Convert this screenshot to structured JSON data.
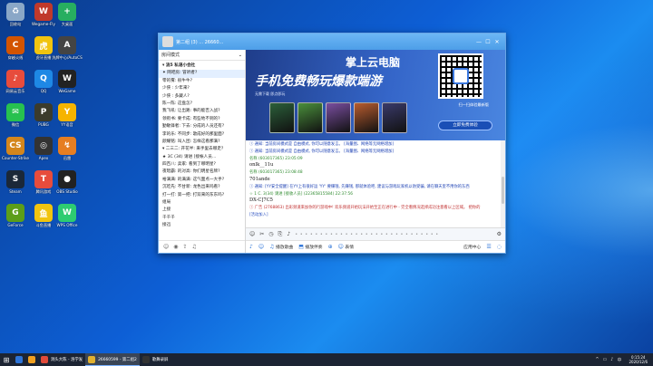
{
  "desktop": {
    "icons": [
      {
        "label": "回收站",
        "color": "#8aa7c7",
        "glyph": "♻"
      },
      {
        "label": "Wegame-Fly",
        "color": "#c0392b",
        "glyph": "W"
      },
      {
        "label": "大桌面",
        "color": "#27ae60",
        "glyph": "+"
      },
      {
        "label": "穿越火线",
        "color": "#d35400",
        "glyph": "C"
      },
      {
        "label": "虎牙直播",
        "color": "#f1c40f",
        "glyph": "虎"
      },
      {
        "label": "洗牌中心/AutoCS",
        "color": "#444",
        "glyph": "A"
      },
      {
        "label": "网易云音乐",
        "color": "#e74c3c",
        "glyph": "♪"
      },
      {
        "label": "QQ",
        "color": "#1e88e5",
        "glyph": "Q"
      },
      {
        "label": "WeGame",
        "color": "#222",
        "glyph": "W"
      },
      {
        "label": "微信",
        "color": "#27c14f",
        "glyph": "✉"
      },
      {
        "label": "PUBG",
        "color": "#3b3b2c",
        "glyph": "P"
      },
      {
        "label": "YY语音",
        "color": "#f6b400",
        "glyph": "Y"
      },
      {
        "label": "Counter-Strike",
        "color": "#d4861c",
        "glyph": "CS"
      },
      {
        "label": "Apex",
        "color": "#333",
        "glyph": "◎"
      },
      {
        "label": "迅雷",
        "color": "#e67e22",
        "glyph": "↯"
      },
      {
        "label": "Steam",
        "color": "#1b2838",
        "glyph": "S"
      },
      {
        "label": "腾讯游戏",
        "color": "#e74c3c",
        "glyph": "T"
      },
      {
        "label": "OBS Studio",
        "color": "#222",
        "glyph": "●"
      },
      {
        "label": "GeForce",
        "color": "#5c9e1a",
        "glyph": "G"
      },
      {
        "label": "斗鱼直播",
        "color": "#f1c40f",
        "glyph": "鱼"
      },
      {
        "label": "WPS Office",
        "color": "#2ecc71",
        "glyph": "W"
      }
    ]
  },
  "window": {
    "title": "第二组 (3‍) ... 26660...",
    "min": "—",
    "max": "☐",
    "close": "✕"
  },
  "left_panel": {
    "header_label": "房间模式",
    "header_icon": "⌄",
    "rows": [
      {
        "text": "▾ 流5 私语小会社",
        "group": true
      },
      {
        "text": "✦ 网吧房: 冒听者?",
        "sel": true
      },
      {
        "text": "零的雾: 很牛牛?"
      },
      {
        "text": "少侠 : 少年来?"
      },
      {
        "text": "少侠 : 多藏人?"
      },
      {
        "text": "陈一陈: 这盘怎?"
      },
      {
        "text": "我飞吼: 让出路: 事的能否入战?"
      },
      {
        "text": "领衔书: 要卡成: 有些地不到的?"
      },
      {
        "text": "勤敏锋者: 下去: 分成的人员还有?"
      },
      {
        "text": "李的乐: 不同步: 歌成好的那里面?"
      },
      {
        "text": "颜耀铭: 叫入团: 怎样这看那满?"
      },
      {
        "text": "▾ 二三二: 开花半: 来手里去哪走?"
      },
      {
        "text": "  ★ 3C (34) 请进 [接帐人员..."
      },
      {
        "text": "四百八: 卖家: 看到了哪明星?"
      },
      {
        "text": "夜暗霸: 的对高: 你们明星名牌?"
      },
      {
        "text": "裕满满: 的满满: 这气面点一大手?"
      },
      {
        "text": "沉吃先: 不甘新: 龙色出来吗看?"
      },
      {
        "text": "打一打: 第一把: 打双来的东东吗?"
      },
      {
        "text": "组局"
      },
      {
        "text": "上接"
      },
      {
        "text": "千千千"
      },
      {
        "text": "接迅"
      }
    ],
    "footer_icons": [
      "☺",
      "◉",
      "⇪",
      "♫"
    ]
  },
  "banner": {
    "title": "掌上云电脑",
    "headline": "手机免费畅玩爆款端游",
    "small_text": "无需下载 即点即玩",
    "qr_caption": "扫一扫体验最新版",
    "button": "立即免费体验",
    "game_colors": [
      "#2b5f3a",
      "#4a8f3c",
      "#7a4ea0",
      "#b85c2f",
      "#3a3a6a"
    ]
  },
  "chat": {
    "messages": [
      {
        "kind": "sys",
        "text": "ⓘ 通知: 当前房间模式是 自由模式, 你可以随意发言。 [海量图、网络等无网络增加]"
      },
      {
        "kind": "sys",
        "text": "ⓘ 通知: 当前房间模式是 自由模式, 你可以随意发言。 [海量图、网络等无网络增加]"
      },
      {
        "kind": "meta",
        "text": "名称 (603017365) 23:05:09"
      },
      {
        "kind": "txt",
        "text": "onlk__11u"
      },
      {
        "kind": "meta",
        "text": "名称 (603017365) 23:08:48"
      },
      {
        "kind": "txt",
        "text": "701ande"
      },
      {
        "kind": "sys",
        "text": "ⓘ 通知: [YY安全提醒] 在YY上有很好运 'YY' 要赚钱, 先赚钱, 那就体验吧, 建议与游戏玩家机以防受骗, 请在聊天里不用你的东西"
      },
      {
        "kind": "meta",
        "text": "  ☆ 1 C. 3(34) 请进 [接收人员] (22365815584) 22:37:56"
      },
      {
        "kind": "txt",
        "text": "DX-C]7C5"
      },
      {
        "kind": "alt",
        "text": "ⓘ 广告 (2768863) 出彩频道来加你的行游戏中! 欢乐频道开始玩法开始至正在进行中 - 完全看情况选择成功注意看以上区域。 把你的"
      },
      {
        "kind": "lnk",
        "text": "[活动加入]"
      }
    ]
  },
  "input_bar": {
    "icons": [
      "☺",
      "✂",
      "◷",
      "⎘",
      "♪"
    ],
    "placeholder": "• • • • • • • • • • • • • • • • • • • • • • • • • • • • •",
    "right": "⚙"
  },
  "bottom_bar": {
    "items": [
      {
        "icon": "♪",
        "label": ""
      },
      {
        "icon": "☺",
        "label": ""
      },
      {
        "icon": "♫",
        "label": "播放歌曲"
      },
      {
        "icon": "⬒",
        "label": "播放伴奏"
      },
      {
        "icon": "⊕",
        "label": ""
      },
      {
        "icon": "☺",
        "label": "表情"
      }
    ],
    "right_label": "应用中心",
    "right_icons": [
      "☰",
      "◌"
    ]
  },
  "taskbar": {
    "start": "⊞",
    "apps": [
      {
        "label": "",
        "color": "#2d74d8"
      },
      {
        "label": "",
        "color": "#f0a020"
      },
      {
        "label": "洞头大陈 - 洛学发",
        "color": "#e04a3a",
        "active": false
      },
      {
        "label": "26660599 - 第二组2",
        "color": "#e0b030",
        "active": true
      },
      {
        "label": "歌舞录屏",
        "color": "#333",
        "active": false
      }
    ],
    "tray": [
      "^",
      "▭",
      "♪",
      "中"
    ],
    "time": "0:15:24",
    "date": "2020/12/6"
  }
}
